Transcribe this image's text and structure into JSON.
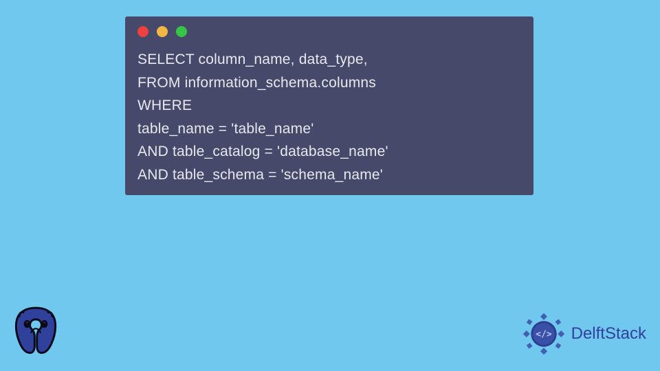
{
  "code": {
    "lines": [
      "SELECT column_name, data_type,",
      "FROM information_schema.columns",
      "WHERE",
      "table_name = 'table_name'",
      "AND table_catalog = 'database_name'",
      "AND table_schema = 'schema_name'"
    ]
  },
  "branding": {
    "delftstack_label": "DelftStack"
  },
  "colors": {
    "background": "#70c8ef",
    "window": "#46496a",
    "code_text": "#e8e8f0",
    "red_dot": "#ed4140",
    "yellow_dot": "#f0b744",
    "green_dot": "#36c549",
    "brand_blue": "#30419b"
  }
}
